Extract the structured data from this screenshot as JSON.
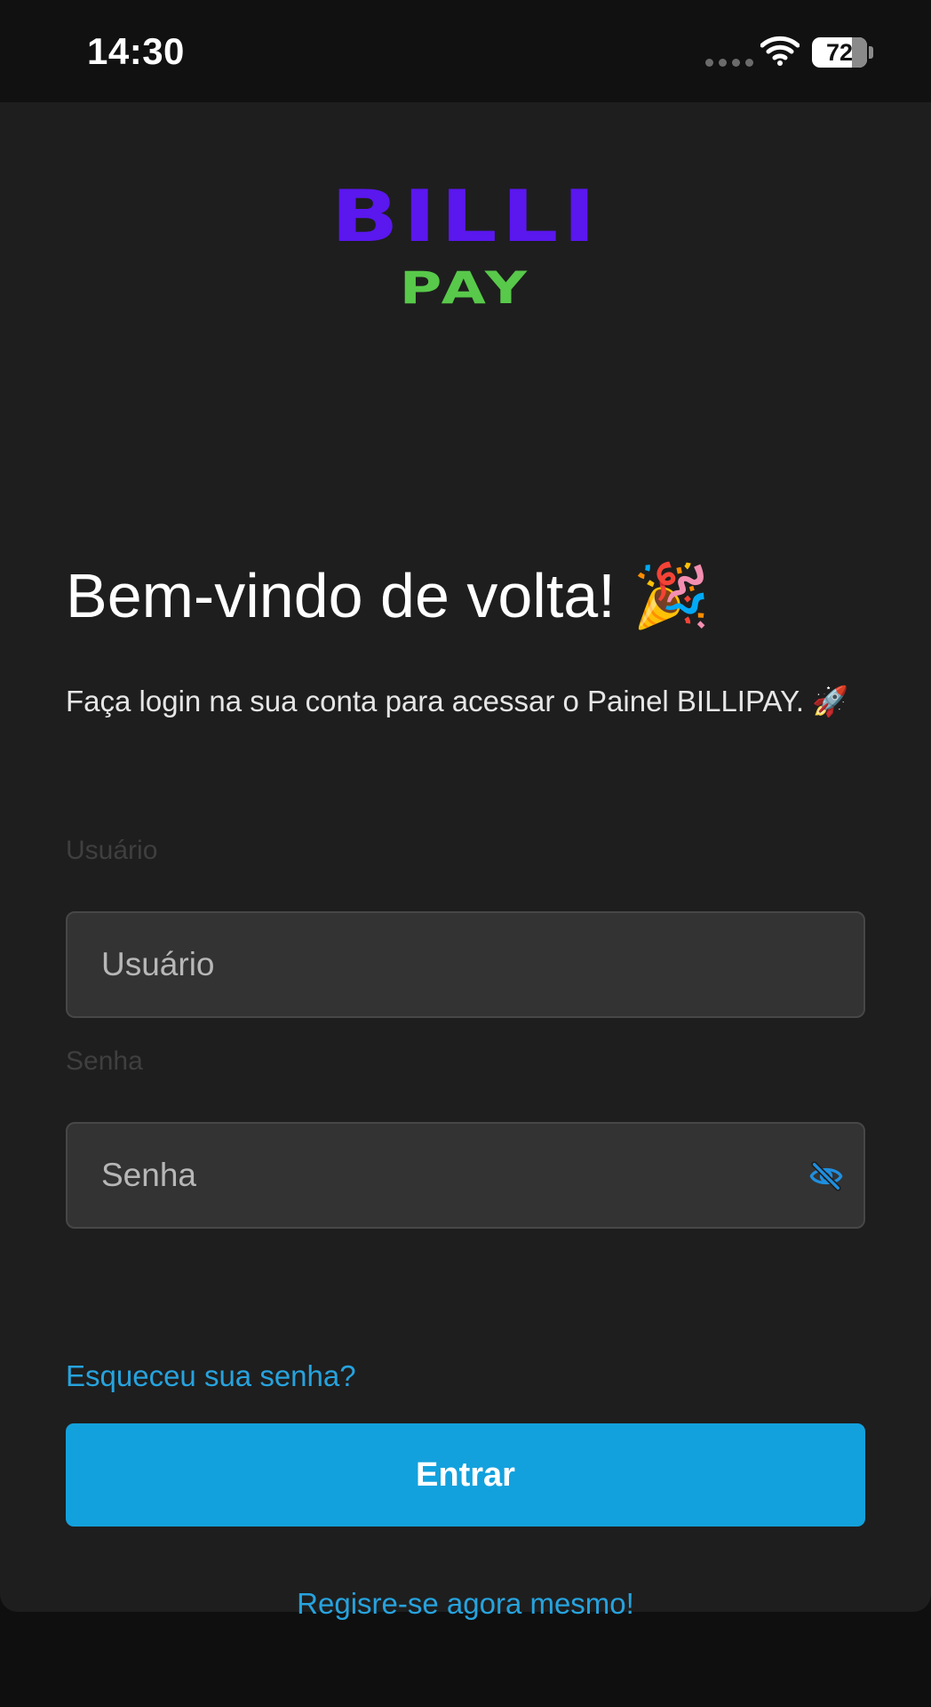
{
  "status_bar": {
    "time": "14:30",
    "battery_level": "72",
    "battery_fraction": 0.72
  },
  "logo": {
    "line1": "BILLI",
    "line2": "PAY",
    "colors": {
      "line1": "#5a17ee",
      "line2": "#58c94a"
    }
  },
  "login": {
    "title": "Bem-vindo de volta!",
    "title_emoji": "🎉",
    "subtitle": "Faça login na sua conta para acessar o Painel BILLIPAY.",
    "subtitle_emoji": "🚀",
    "username": {
      "label": "Usuário",
      "placeholder": "Usuário",
      "value": ""
    },
    "password": {
      "label": "Senha",
      "placeholder": "Senha",
      "value": "",
      "toggle_icon": "eye-off-icon"
    },
    "forgot_password": "Esqueceu sua senha?",
    "submit_label": "Entrar",
    "register_link": "Regisre-se agora mesmo!"
  },
  "theme": {
    "accent": "#13a1dd",
    "link": "#27a3de",
    "background": "#1e1e1e"
  }
}
